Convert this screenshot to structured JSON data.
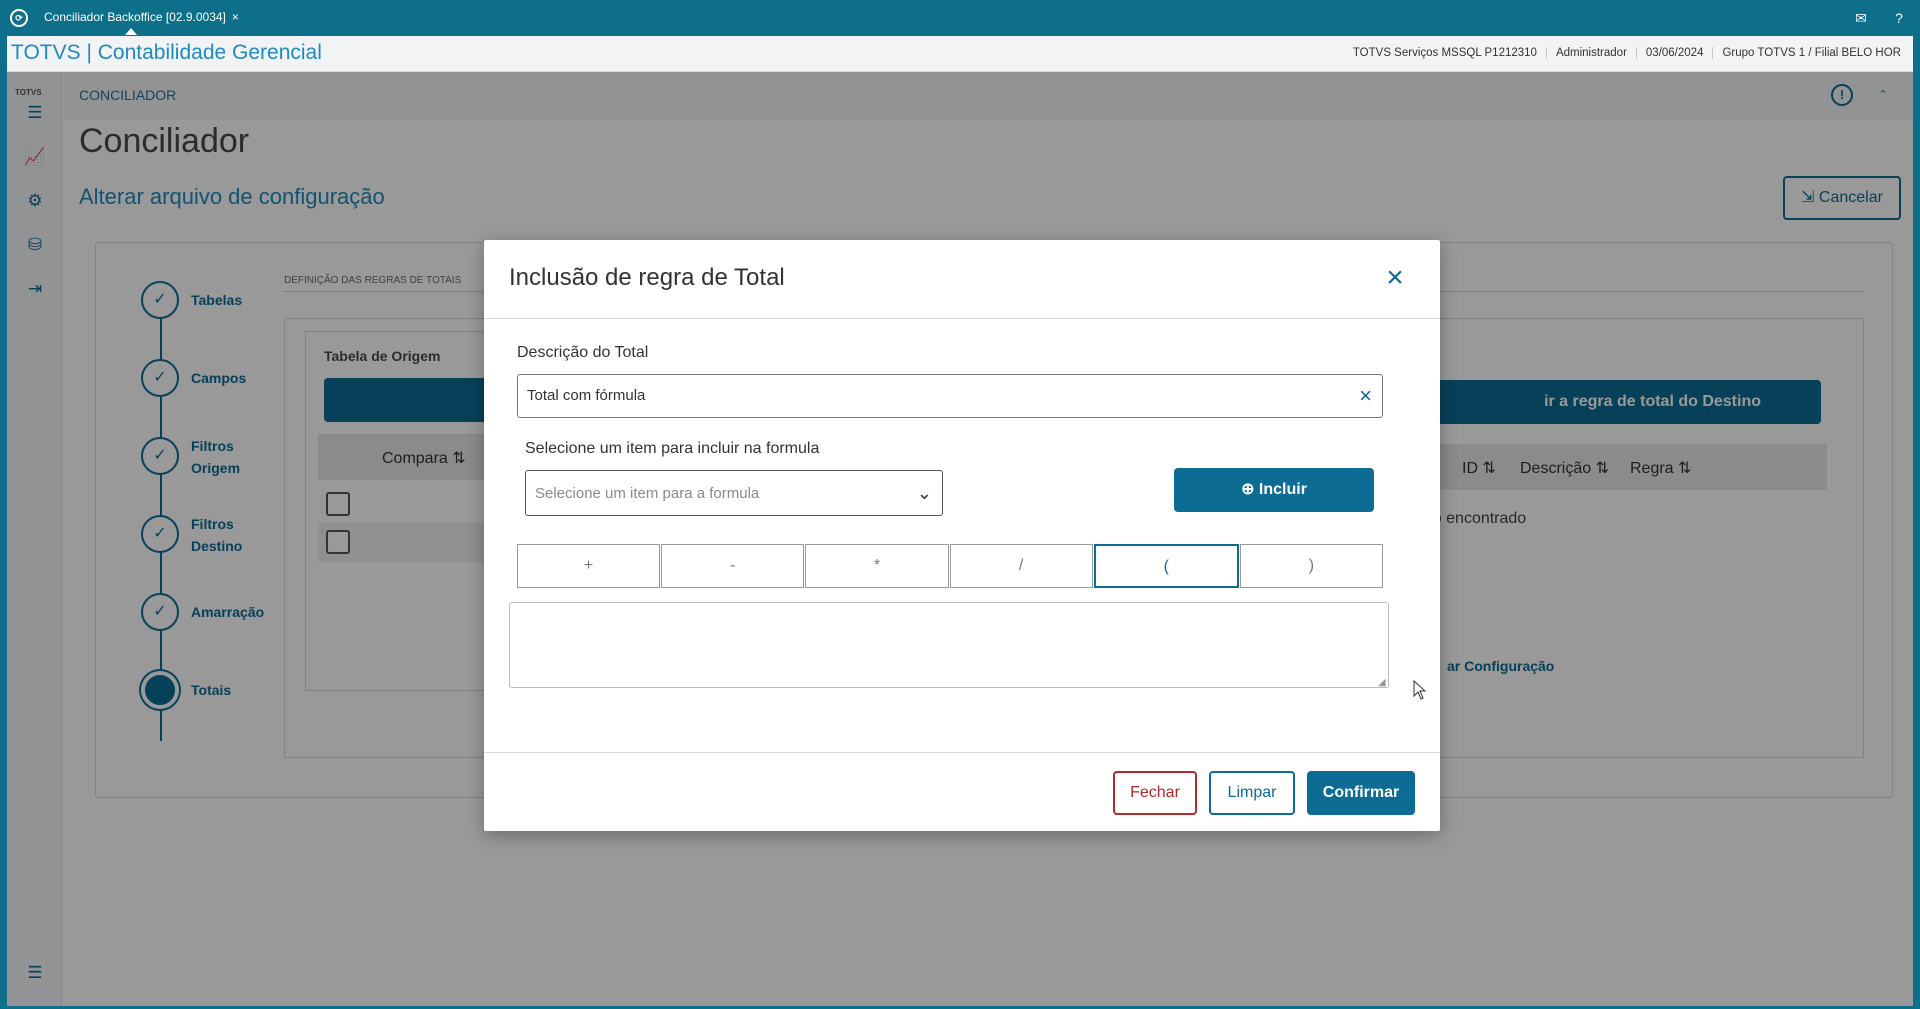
{
  "window": {
    "tab_title": "Conciliador Backoffice [02.9.0034]",
    "tab_close": "×",
    "mail_icon": "mail-icon",
    "help_icon": "help-icon"
  },
  "app_header": {
    "title": "TOTVS | Contabilidade Gerencial",
    "info": [
      "TOTVS Serviços MSSQL P1212310",
      "Administrador",
      "03/06/2024",
      "Grupo TOTVS 1 / Filial BELO HOR"
    ]
  },
  "sidebar": {
    "logo": "TOTVS",
    "icons": [
      "list-icon",
      "chart-icon",
      "gear-icon",
      "database-icon",
      "logout-icon",
      "expand-menu-icon"
    ]
  },
  "topbar": {
    "breadcrumb": "CONCILIADOR"
  },
  "page": {
    "title": "Conciliador",
    "subtitle": "Alterar arquivo de configuração",
    "cancel_label": "Cancelar"
  },
  "stepper": {
    "steps": [
      {
        "label": "Tabelas",
        "state": "done"
      },
      {
        "label": "Campos",
        "state": "done"
      },
      {
        "label": "Filtros Origem",
        "state": "done"
      },
      {
        "label": "Filtros Destino",
        "state": "done"
      },
      {
        "label": "Amarração",
        "state": "done"
      },
      {
        "label": "Totais",
        "state": "active"
      }
    ]
  },
  "totals_section": {
    "title": "DEFINIÇÃO DAS REGRAS DE TOTAIS",
    "origin_title": "Tabela de Origem",
    "origin_columns": [
      "Compara"
    ],
    "dest_button": "ir a regra de total do Destino",
    "dest_columns": [
      "ID",
      "Descrição",
      "Regra"
    ],
    "dest_empty": "ado encontrado",
    "finish_link": "ar Configuração"
  },
  "modal": {
    "title": "Inclusão de regra de Total",
    "desc_label": "Descrição do Total",
    "desc_value": "Total com fórmula",
    "select_label": "Selecione um item para incluir na formula",
    "select_placeholder": "Selecione um item para a formula",
    "include_label": "Incluir",
    "operators": [
      "+",
      "-",
      "*",
      "/",
      "(",
      ")"
    ],
    "formula_value": "",
    "fechar_label": "Fechar",
    "limpar_label": "Limpar",
    "confirmar_label": "Confirmar"
  },
  "colors": {
    "brand": "#0e6f8a",
    "primary": "#0c6c94",
    "danger": "#b42a2a",
    "link": "#1f8ac0"
  }
}
